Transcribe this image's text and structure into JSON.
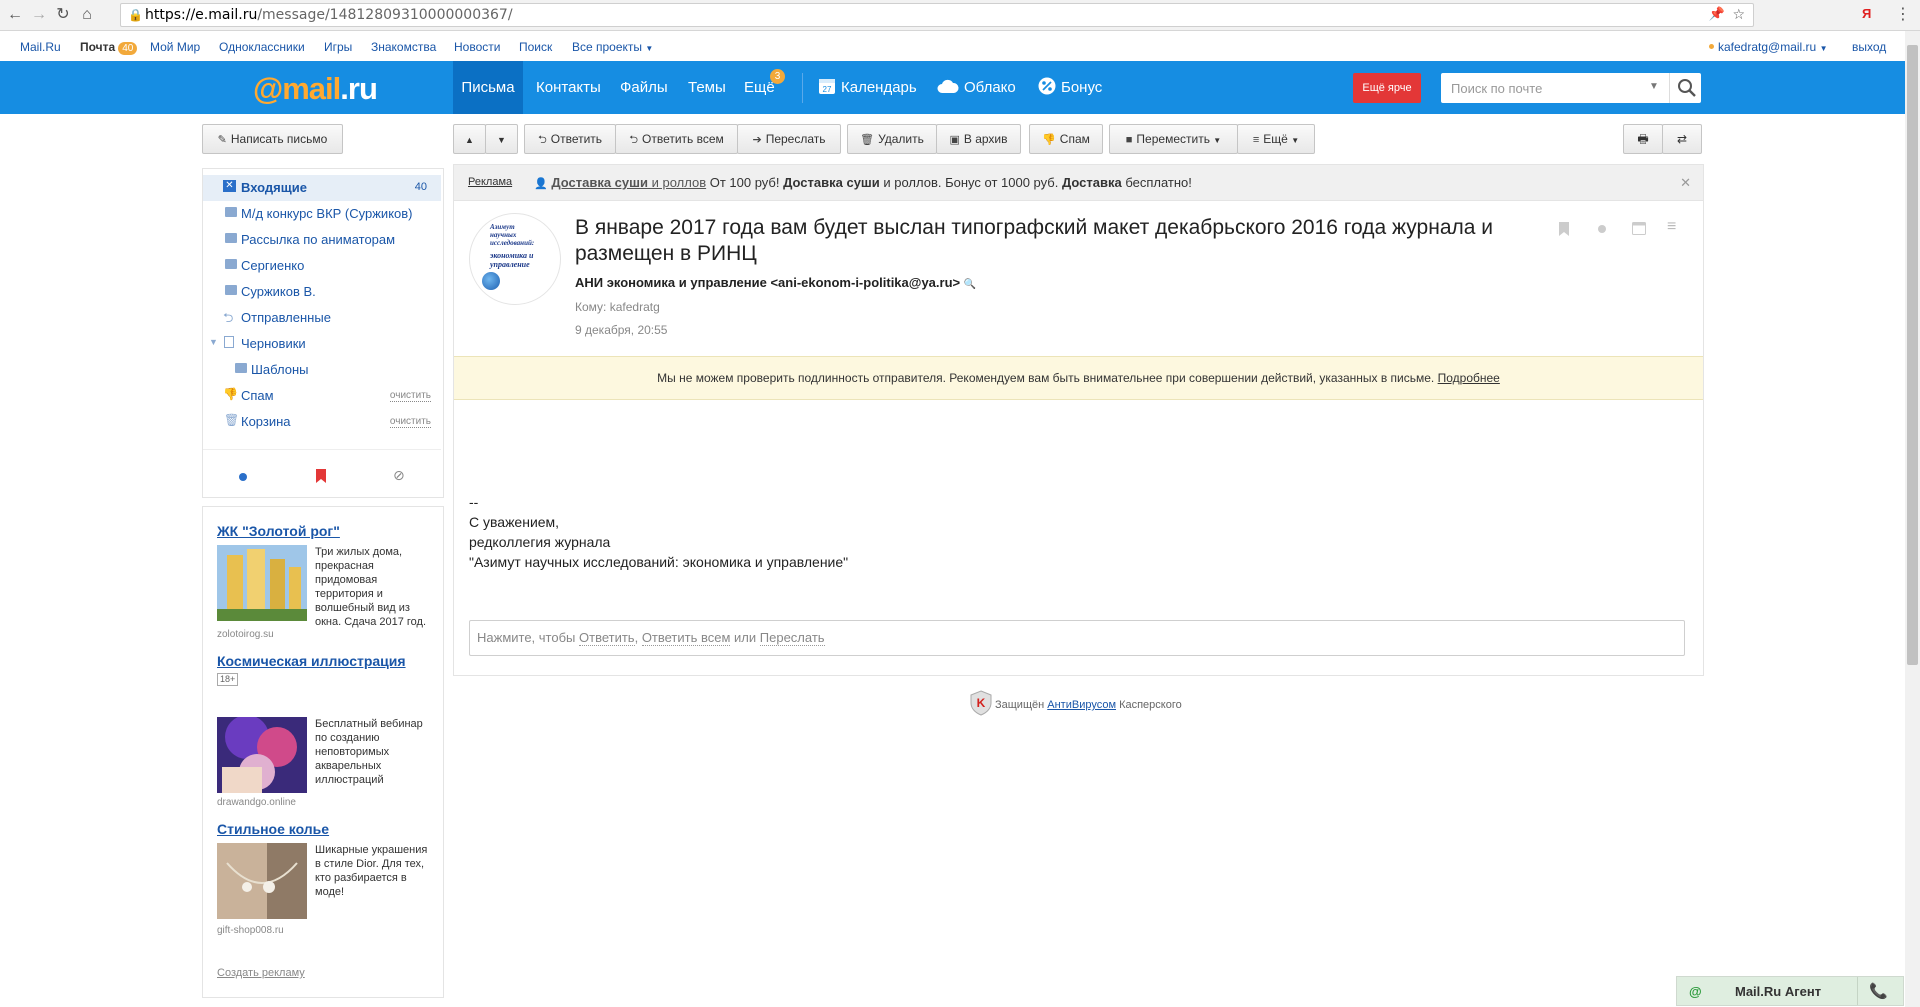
{
  "browser": {
    "url_host": "https://e.mail.ru",
    "url_path": "/message/14812809310000000367/",
    "ya_label": "Я"
  },
  "portal": {
    "links": [
      "Mail.Ru",
      "Почта",
      "Мой Мир",
      "Одноклассники",
      "Игры",
      "Знакомства",
      "Новости",
      "Поиск",
      "Все проекты"
    ],
    "mail_count": "40",
    "user_email": "kafedratg@mail.ru",
    "logout": "выход"
  },
  "header": {
    "logo_at": "@mail",
    "logo_ru": ".ru",
    "tabs": [
      "Письма",
      "Контакты",
      "Файлы",
      "Темы",
      "Ещё"
    ],
    "more_badge": "3",
    "calendar_day": "27",
    "services": [
      "Календарь",
      "Облако",
      "Бонус"
    ],
    "brighter_button": "Ещё ярче",
    "search_placeholder": "Поиск по почте"
  },
  "toolbar": {
    "compose": "Написать письмо",
    "reply": "Ответить",
    "reply_all": "Ответить всем",
    "forward": "Переслать",
    "delete": "Удалить",
    "archive": "В архив",
    "spam": "Спам",
    "move": "Переместить",
    "more": "Ещё"
  },
  "folders": [
    {
      "label": "Входящие",
      "count": "40"
    },
    {
      "label": "М/д конкурс ВКР (Суржиков)"
    },
    {
      "label": "Рассылка по аниматорам"
    },
    {
      "label": "Сергиенко"
    },
    {
      "label": "Суржиков В."
    },
    {
      "label": "Отправленные"
    },
    {
      "label": "Черновики"
    },
    {
      "label": "Шаблоны"
    },
    {
      "label": "Спам",
      "action": "очистить"
    },
    {
      "label": "Корзина",
      "action": "очистить"
    }
  ],
  "ads": [
    {
      "title": "ЖК \"Золотой рог\"",
      "text": "Три жилых дома, прекрасная придомовая территория и волшебный вид из окна. Сдача 2017 год.",
      "source": "zolotoirog.su"
    },
    {
      "title": "Космическая иллюстрация",
      "age": "18+",
      "text": "Бесплатный вебинар по созданию неповторимых акварельных иллюстраций",
      "source": "drawandgo.online"
    },
    {
      "title": "Стильное колье",
      "text": "Шикарные украшения в стиле Dior. Для тех, кто разбирается в моде!",
      "source": "gift-shop008.ru"
    }
  ],
  "ads_create": "Создать рекламу",
  "ad_strip": {
    "label": "Реклама",
    "link": "Доставка суши",
    "link_suffix": " и роллов",
    "t1": " От 100 руб! ",
    "b1": "Доставка суши",
    "t2": " и роллов. Бонус от 1000 руб. ",
    "b2": "Доставка",
    "t3": " бесплатно!"
  },
  "message": {
    "avatar_lines": [
      "Азимут",
      "научных",
      "исследований:",
      "экономика и",
      "управление"
    ],
    "subject": "В январе 2017 года вам будет выслан типографский макет декабрьского 2016 года журнала и размещен в РИНЦ",
    "sender": "АНИ экономика и управление <ani-ekonom-i-politika@ya.ru>",
    "to": "Кому: kafedratg",
    "date": "9 декабря, 20:55",
    "warning": "Мы не можем проверить подлинность отправителя. Рекомендуем вам быть внимательнее при совершении действий, указанных в письме.",
    "warning_link": "Подробнее",
    "body": [
      "--",
      "С уважением,",
      "редколлегия журнала",
      "\"Азимут научных исследований: экономика и управление\""
    ],
    "reply_prefix": "Нажмите, чтобы ",
    "reply_link1": "Ответить",
    "reply_link2": "Ответить всем",
    "reply_or": " или ",
    "reply_link3": "Переслать"
  },
  "kaspersky": {
    "prefix": "Защищён ",
    "link": "АнтиВирусом",
    "suffix": " Касперского"
  },
  "agent": {
    "label": "Mail.Ru Агент"
  },
  "colors": {
    "header_blue": "#168de2",
    "active_tab": "#0b70c4",
    "brighter_red": "#e33737",
    "logo_orange": "#ffa930",
    "warning_bg": "#fdf8df"
  }
}
